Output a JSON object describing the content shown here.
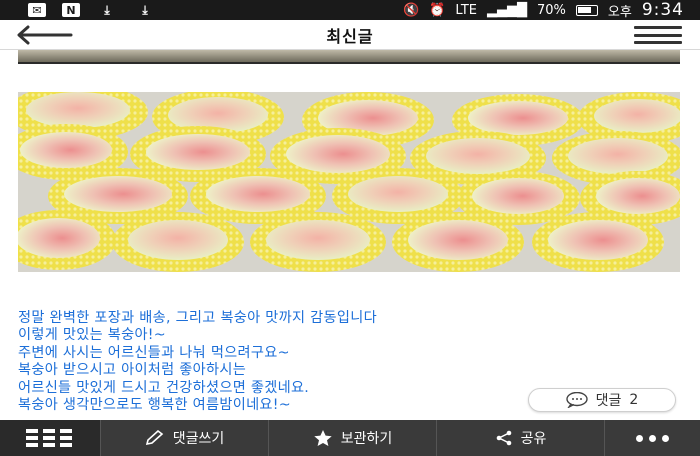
{
  "status_bar": {
    "notif_icons": [
      "message-icon",
      "n-icon",
      "download-icon",
      "download-icon"
    ],
    "network": "LTE",
    "battery_percent": "70%",
    "ampm": "오후",
    "time": "9:34"
  },
  "header": {
    "title": "최신글",
    "back_icon": "back-arrow-icon",
    "menu_icon": "hamburger-icon"
  },
  "post": {
    "lines": [
      "정말 완벽한 포장과 배송, 그리고 복숭아 맛까지 감동입니다",
      "이렇게 맛있는 복숭아!~",
      "주변에 사시는 어르신들과 나눠 먹으려구요~",
      "복숭아 받으시고 아이처럼 좋아하시는",
      "어르신들 맛있게 드시고 건강하셨으면 좋겠네요.",
      "복숭아 생각만으로도 행복한 여름밤이네요!~"
    ]
  },
  "comment_button": {
    "label": "댓글",
    "count": "2"
  },
  "bottom_bar": {
    "write_comment": "댓글쓰기",
    "save": "보관하기",
    "share": "공유"
  },
  "colors": {
    "text_blue": "#1d6fd8",
    "bottom_bar": "#3a3a3a",
    "status_bar": "#1a1a1a"
  }
}
